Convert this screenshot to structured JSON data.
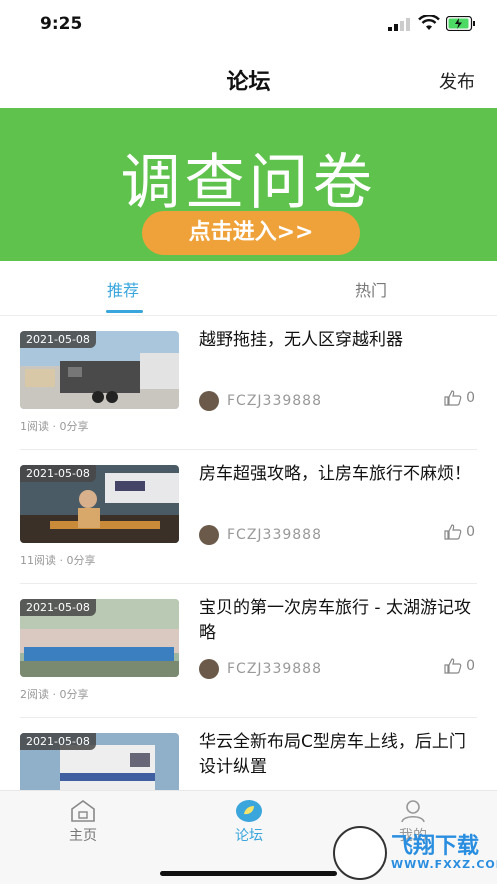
{
  "status_bar": {
    "time": "9:25"
  },
  "nav": {
    "title": "论坛",
    "publish_label": "发布"
  },
  "banner": {
    "main_text": "调查问卷",
    "button_text": "点击进入>>",
    "bg_color": "#5fc24c"
  },
  "tabs": [
    {
      "label": "推荐",
      "active": true
    },
    {
      "label": "热门",
      "active": false
    }
  ],
  "posts": [
    {
      "date": "2021-05-08",
      "title": "越野拖挂，无人区穿越利器",
      "author": "FCZJ339888",
      "likes": "0",
      "stats": "1阅读 · 0分享"
    },
    {
      "date": "2021-05-08",
      "title": "房车超强攻略，让房车旅行不麻烦！",
      "author": "FCZJ339888",
      "likes": "0",
      "stats": "11阅读 · 0分享"
    },
    {
      "date": "2021-05-08",
      "title": "宝贝的第一次房车旅行 - 太湖游记攻略",
      "author": "FCZJ339888",
      "likes": "0",
      "stats": "2阅读 · 0分享"
    },
    {
      "date": "2021-05-08",
      "title": "华云全新布局C型房车上线，后上门设计纵置",
      "author": "",
      "likes": "",
      "stats": ""
    }
  ],
  "bottom_tabs": [
    {
      "label": "主页",
      "icon": "home-icon"
    },
    {
      "label": "论坛",
      "icon": "forum-icon"
    },
    {
      "label": "我的",
      "icon": "user-icon"
    }
  ],
  "watermark": {
    "title": "飞翔下载",
    "url": "WWW.FXXZ.COM"
  },
  "colors": {
    "accent": "#3aa6dc",
    "banner_green": "#5fc24c",
    "button_orange": "#f0a23a"
  }
}
